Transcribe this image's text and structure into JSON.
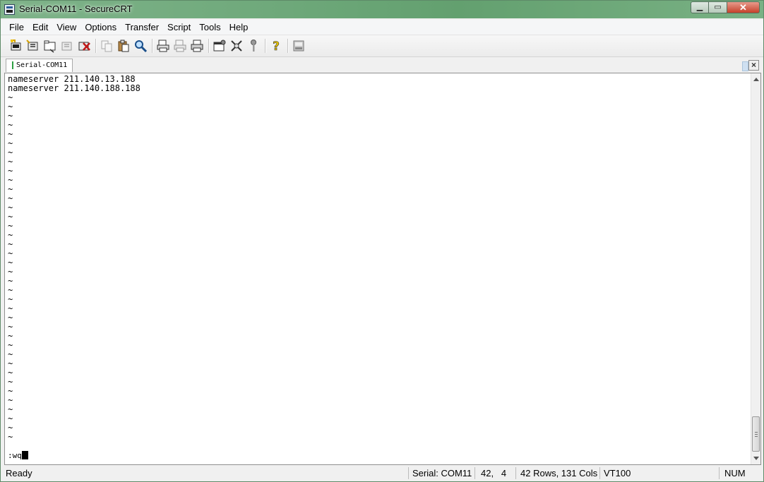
{
  "window": {
    "title": "Serial-COM11 - SecureCRT"
  },
  "menubar": {
    "items": [
      "File",
      "Edit",
      "View",
      "Options",
      "Transfer",
      "Script",
      "Tools",
      "Help"
    ]
  },
  "toolbar": {
    "icons": [
      "connect-icon",
      "quick-connect-icon",
      "connect-in-tab-icon",
      "reconnect-icon",
      "disconnect-icon",
      "copy-icon",
      "paste-icon",
      "find-icon",
      "print-screen-icon",
      "print-selection-icon",
      "print-icon",
      "session-options-icon",
      "global-options-icon",
      "keymap-icon",
      "help-icon",
      "sftp-icon"
    ]
  },
  "tabs": [
    {
      "label": "Serial-COM11",
      "status": "connected"
    }
  ],
  "terminal": {
    "lines": [
      "nameserver 211.140.13.188",
      "nameserver 211.140.188.188",
      "~",
      "~",
      "~",
      "~",
      "~",
      "~",
      "~",
      "~",
      "~",
      "~",
      "~",
      "~",
      "~",
      "~",
      "~",
      "~",
      "~",
      "~",
      "~",
      "~",
      "~",
      "~",
      "~",
      "~",
      "~",
      "~",
      "~",
      "~",
      "~",
      "~",
      "~",
      "~",
      "~",
      "~",
      "~",
      "~",
      "~",
      "~"
    ],
    "command": ":wq"
  },
  "statusbar": {
    "ready": "Ready",
    "connection": "Serial: COM11",
    "position": "42,   4",
    "size": "42 Rows, 131 Cols",
    "emulation": "VT100",
    "num": "NUM"
  },
  "colors": {
    "titlebar": "#6fa97b",
    "tab_status": "#2ea043",
    "close_button": "#c6412b"
  }
}
